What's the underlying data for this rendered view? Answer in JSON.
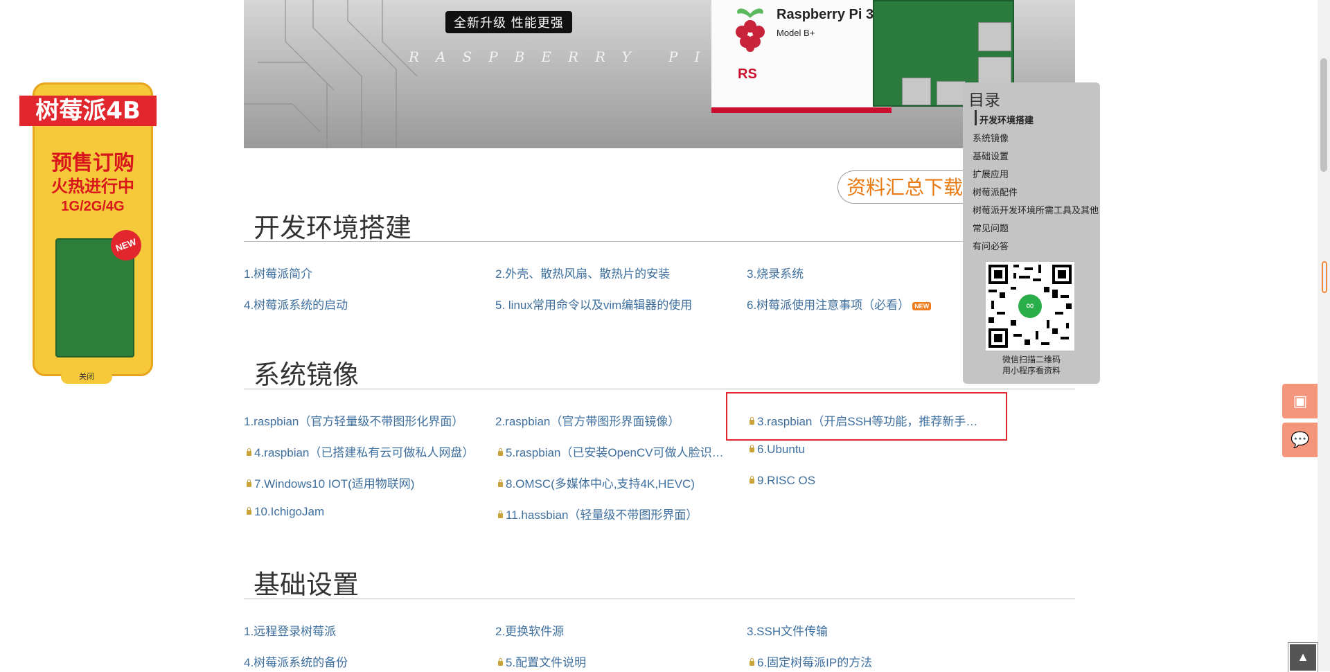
{
  "banner": {
    "slogan": "全新升级 性能更强",
    "brand": "RASPBERRY PI",
    "product_title": "Raspberry Pi 3",
    "product_model": "Model B+",
    "rs_logo": "RS"
  },
  "ad": {
    "ribbon": "树莓派4B",
    "line1": "预售订购",
    "line2": "火热进行中",
    "line3": "1G/2G/4G",
    "new_badge": "NEW",
    "close": "关闭"
  },
  "download_label": "资料汇总下载",
  "sections": {
    "dev_env": {
      "title": "开发环境搭建",
      "links": [
        "1.树莓派简介",
        "2.外壳、散热风扇、散热片的安装",
        "3.烧录系统",
        "4.树莓派系统的启动",
        "5. linux常用命令以及vim编辑器的使用",
        "6.树莓派使用注意事项（必看）"
      ],
      "new_label": "NEW"
    },
    "images": {
      "title": "系统镜像",
      "links": [
        "1.raspbian（官方轻量级不带图形化界面）",
        "2.raspbian（官方带图形界面镜像）",
        "3.raspbian（开启SSH等功能，推荐新手…",
        "4.raspbian（已搭建私有云可做私人网盘）",
        "5.raspbian（已安装OpenCV可做人脸识…",
        "6.Ubuntu",
        "7.Windows10 IOT(适用物联网)",
        "8.OMSC(多媒体中心,支持4K,HEVC)",
        "9.RISC OS",
        "10.IchigoJam",
        "11.hassbian（轻量级不带图形界面）"
      ]
    },
    "basic": {
      "title": "基础设置",
      "links": [
        "1.远程登录树莓派",
        "2.更换软件源",
        "3.SSH文件传输",
        "4.树莓派系统的备份",
        "5.配置文件说明",
        "6.固定树莓派IP的方法"
      ]
    }
  },
  "toc": {
    "title": "目录",
    "items": [
      "开发环境搭建",
      "系统镜像",
      "基础设置",
      "扩展应用",
      "树莓派配件",
      "树莓派开发环境所需工具及其他",
      "常见问题",
      "有问必答"
    ],
    "qr_caption1": "微信扫描二维码",
    "qr_caption2": "用小程序看资料"
  },
  "icons": {
    "save": "save-icon",
    "chat": "chat-icon",
    "to_top": "arrow-up-icon",
    "lock": "lock-icon"
  },
  "colors": {
    "link": "#3e6f9e",
    "download": "#e87a14",
    "highlight": "#e0252f",
    "ad_bg": "#f5c93a",
    "ad_red": "#e1262e",
    "float_btn": "#f3967b"
  }
}
